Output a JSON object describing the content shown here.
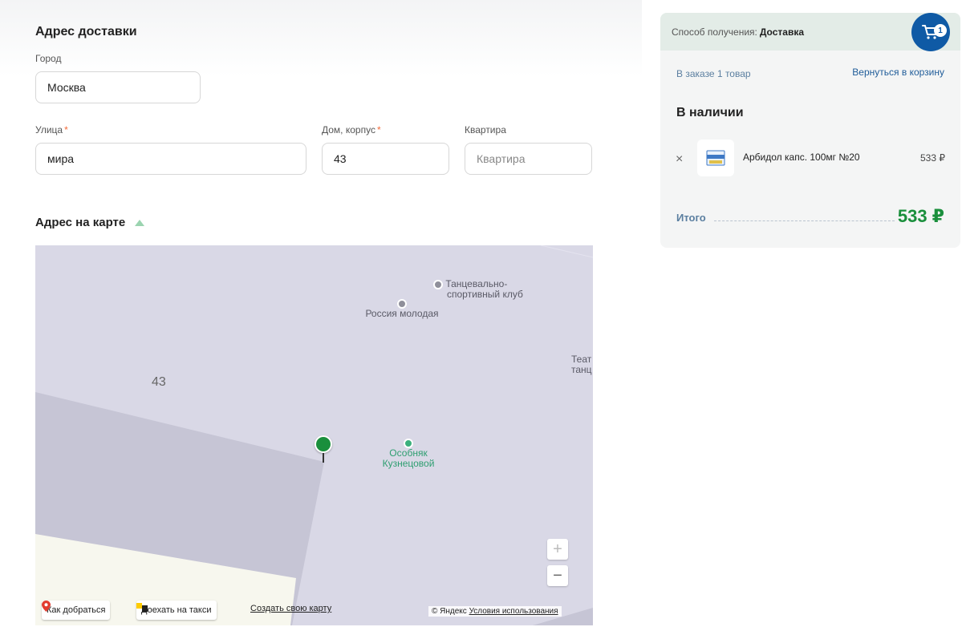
{
  "form": {
    "title": "Адрес доставки",
    "city_label": "Город",
    "city_value": "Москва",
    "street_label": "Улица",
    "street_value": "мира",
    "house_label": "Дом, корпус",
    "house_value": "43",
    "apt_label": "Квартира",
    "apt_placeholder": "Квартира",
    "required_mark": "*"
  },
  "map": {
    "title": "Адрес на карте",
    "house_number": "43",
    "poi_dance_line1": "Танцевально-",
    "poi_dance_line2": "спортивный клуб",
    "poi_russia": "Россия молодая",
    "poi_theatre_line1": "Теат",
    "poi_theatre_line2": "танц",
    "poi_mansion_line1": "Особняк",
    "poi_mansion_line2": "Кузнецовой",
    "zoom_in": "+",
    "zoom_out": "−",
    "route_btn": "Как добраться",
    "taxi_btn": "Доехать на такси",
    "create_map_link": "Создать свою карту",
    "copyright": "© Яндекс",
    "terms_link": "Условия использования"
  },
  "order": {
    "method_label": "Способ получения:",
    "method_value": "Доставка",
    "cart_count": "1",
    "items_count_text": "В заказе 1 товар",
    "back_link": "Вернуться в корзину",
    "availability_title": "В наличии",
    "items": [
      {
        "name": "Арбидол капс. 100мг №20",
        "price": "533 ₽"
      }
    ],
    "remove_icon": "×",
    "total_label": "Итого",
    "total_value": "533 ₽"
  },
  "colors": {
    "brand_green": "#1a8f3c",
    "brand_blue": "#0f5aa5",
    "required": "#f26b3a"
  }
}
